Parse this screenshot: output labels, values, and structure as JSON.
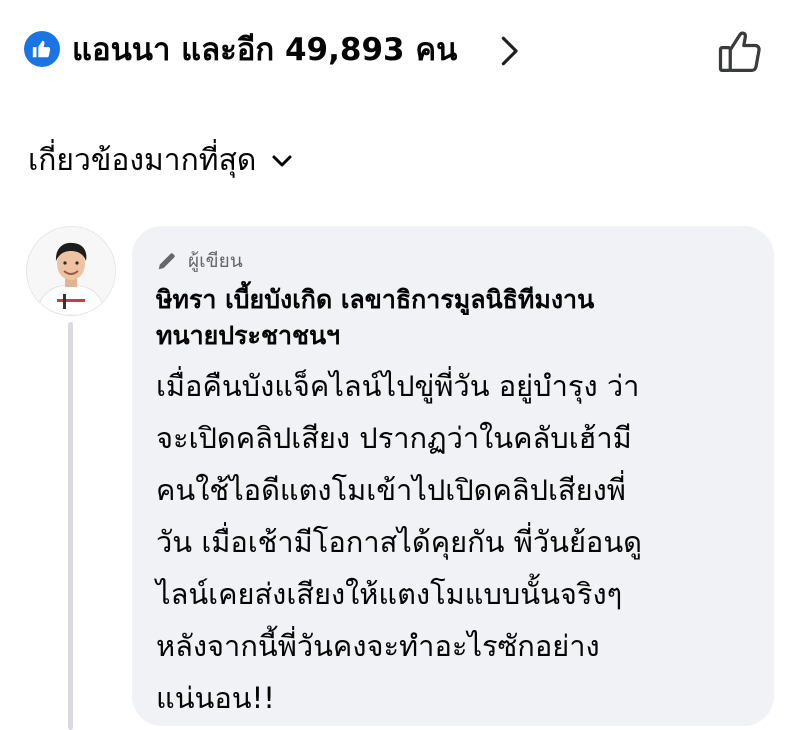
{
  "reactions": {
    "summary": "แอนนา และอีก 49,893 คน",
    "badge_icon": "like-icon",
    "action_icon": "thumbs-up-outline-icon",
    "accent": "#1b74e4"
  },
  "sort": {
    "label": "เกี่ยวข้องมากที่สุด",
    "icon": "chevron-down-icon"
  },
  "comment": {
    "badge_label": "ผู้เขียน",
    "author_lines": [
      "ษิทรา เบี้ยบังเกิด เลขาธิการมูลนิธิทีมงาน",
      "ทนายประชาชนฯ"
    ],
    "body_lines": [
      "เมื่อคืนบังแจ็คไลน์ไปขู่พี่วัน อยู่บำรุง ว่า",
      "จะเปิดคลิปเสียง ปรากฏว่าในคลับเฮ้ามี",
      "คนใช้ไอดีแตงโมเข้าไปเปิดคลิปเสียงพี่",
      "วัน เมื่อเช้ามีโอกาสได้คุยกัน พี่วันย้อนดู",
      "ไลน์เคยส่งเสียงให้แตงโมแบบนั้นจริงๆ",
      "หลังจากนี้พี่วันคงจะทำอะไรซักอย่าง",
      "แน่นอน!!"
    ]
  }
}
